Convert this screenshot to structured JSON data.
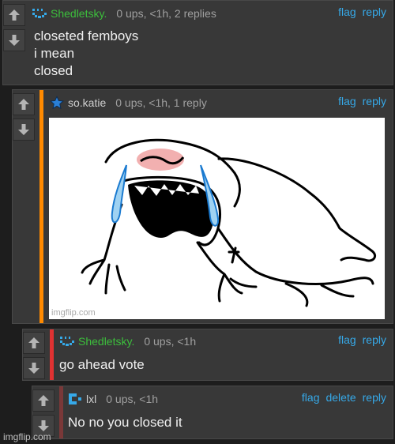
{
  "colors": {
    "link": "#36a9e8",
    "username_green": "#3cbf3c",
    "meta": "#a0a0a0",
    "accent_orange": "#ff8a00",
    "accent_red": "#e03232",
    "accent_maroon": "#7a3838"
  },
  "comments": [
    {
      "username": "Shedletsky.",
      "meta": "0 ups, <1h, 2 replies",
      "actions": [
        "flag",
        "reply"
      ],
      "lines": [
        "closeted femboys",
        "i mean",
        "closed"
      ],
      "avatar": "pixel-face-icon"
    },
    {
      "username": "so.katie",
      "meta": "0 ups, <1h, 1 reply",
      "actions": [
        "flag",
        "reply"
      ],
      "image_watermark": "imgflip.com",
      "avatar": "star-icon"
    },
    {
      "username": "Shedletsky.",
      "meta": "0 ups, <1h",
      "actions": [
        "flag",
        "reply"
      ],
      "lines": [
        "go ahead vote"
      ],
      "avatar": "pixel-face-icon"
    },
    {
      "username": "lxl",
      "meta": "0 ups, <1h",
      "actions": [
        "flag",
        "delete",
        "reply"
      ],
      "lines": [
        "No no you closed it"
      ],
      "avatar": "pixel-bracket-icon"
    }
  ],
  "footer_watermark": "imgflip.com"
}
